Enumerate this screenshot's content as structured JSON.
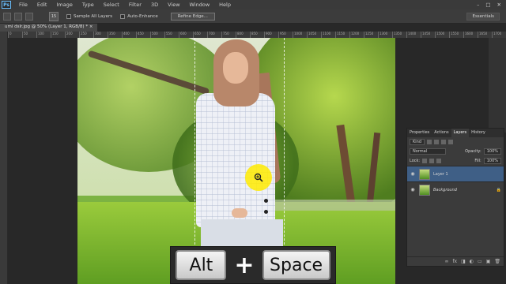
{
  "menubar": {
    "logo": "Ps",
    "items": [
      "File",
      "Edit",
      "Image",
      "Type",
      "Select",
      "Filter",
      "3D",
      "View",
      "Window",
      "Help"
    ],
    "window_controls": [
      "–",
      "□",
      "✕"
    ]
  },
  "options": {
    "brush_size": "15",
    "sample_all_layers": "Sample All Layers",
    "auto_enhance": "Auto-Enhance",
    "refine_edge": "Refine Edge...",
    "workspace": "Essentials"
  },
  "document": {
    "tab_title": "umi dslr.jpg @ 50% (Layer 1, RGB/8) *",
    "tab_close": "×"
  },
  "ruler_ticks": [
    "0",
    "50",
    "100",
    "150",
    "200",
    "250",
    "300",
    "350",
    "400",
    "450",
    "500",
    "550",
    "600",
    "650",
    "700",
    "750",
    "800",
    "850",
    "900",
    "950",
    "1000",
    "1050",
    "1100",
    "1150",
    "1200",
    "1250",
    "1300",
    "1350",
    "1400",
    "1450",
    "1500",
    "1550",
    "1600",
    "1650",
    "1700",
    "1750",
    "1800",
    "1850",
    "1900",
    "1950",
    "2000"
  ],
  "layers_panel": {
    "tabs": [
      "Properties",
      "Actions",
      "Layers",
      "History"
    ],
    "active_tab": "Layers",
    "filter_label": "Kind",
    "blend_mode": "Normal",
    "opacity_label": "Opacity:",
    "opacity_value": "100%",
    "lock_label": "Lock:",
    "fill_label": "Fill:",
    "fill_value": "100%",
    "layers": [
      {
        "name": "Layer 1",
        "selected": true
      },
      {
        "name": "Background",
        "selected": false,
        "locked": true
      }
    ],
    "bottom_icons": [
      "link-icon",
      "fx-icon",
      "mask-icon",
      "adjustment-icon",
      "folder-icon",
      "new-layer-icon",
      "trash-icon"
    ]
  },
  "keyboard_overlay": {
    "key1": "Alt",
    "plus": "+",
    "key2": "Space"
  },
  "colors": {
    "zoom_highlight": "#ffeb00",
    "selected_layer": "#3f5f86"
  }
}
